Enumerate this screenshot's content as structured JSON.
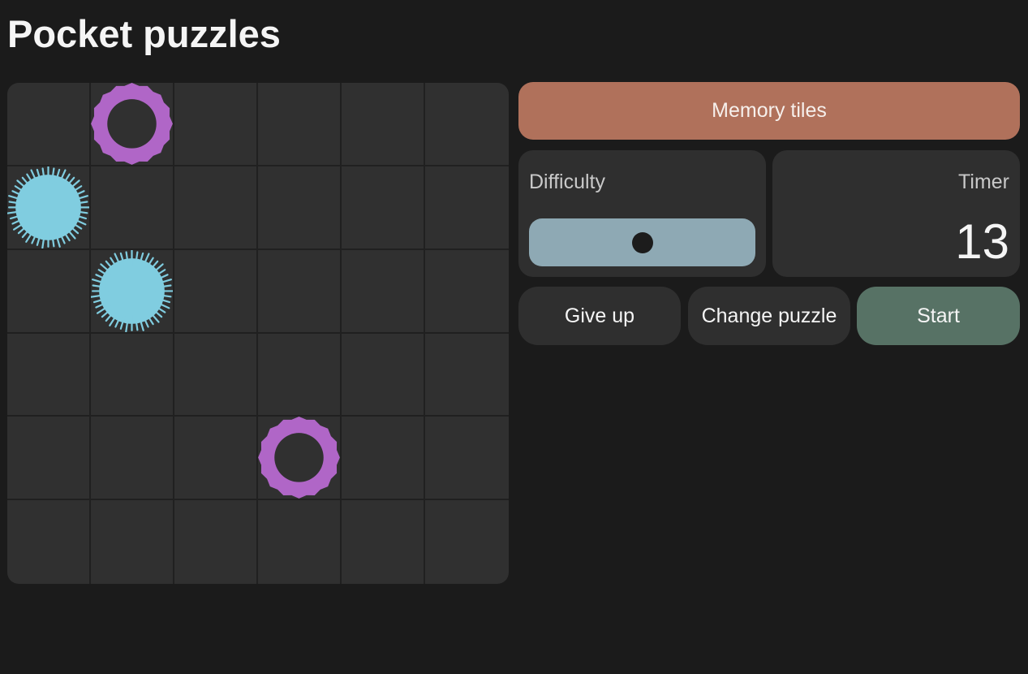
{
  "app": {
    "title": "Pocket puzzles"
  },
  "game": {
    "name": "Memory tiles",
    "grid": {
      "rows": 6,
      "cols": 6,
      "tiles": [
        {
          "row": 0,
          "col": 1,
          "icon": "ring-icon",
          "color": "#b066c7"
        },
        {
          "row": 1,
          "col": 0,
          "icon": "burst-icon",
          "color": "#80cde0"
        },
        {
          "row": 2,
          "col": 1,
          "icon": "burst-icon",
          "color": "#80cde0"
        },
        {
          "row": 4,
          "col": 3,
          "icon": "ring-icon",
          "color": "#b066c7"
        }
      ]
    }
  },
  "difficulty": {
    "label": "Difficulty",
    "value": 0.5
  },
  "timer": {
    "label": "Timer",
    "value": "13"
  },
  "actions": {
    "give_up": "Give up",
    "change_puzzle": "Change puzzle",
    "start": "Start"
  },
  "colors": {
    "background": "#1b1b1b",
    "board": "#303030",
    "title_bar": "#b0715b",
    "slider": "#8ea9b4",
    "start_button": "#577265",
    "ring": "#b066c7",
    "burst": "#80cde0"
  }
}
